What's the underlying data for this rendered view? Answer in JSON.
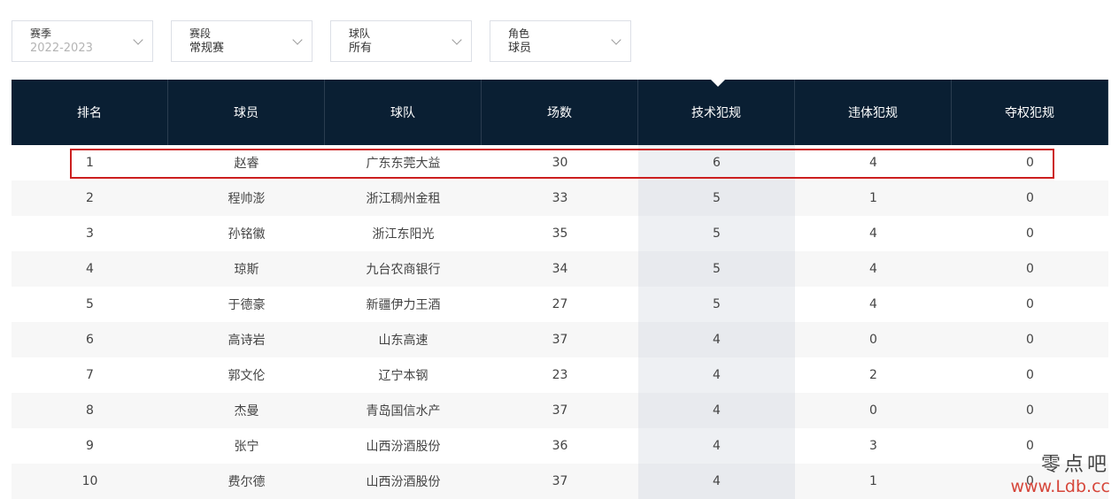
{
  "filters": [
    {
      "label": "赛季",
      "value": "2022-2023",
      "disabled": true
    },
    {
      "label": "赛段",
      "value": "常规赛",
      "disabled": false
    },
    {
      "label": "球队",
      "value": "所有",
      "disabled": false
    },
    {
      "label": "角色",
      "value": "球员",
      "disabled": false
    }
  ],
  "table": {
    "headers": [
      "排名",
      "球员",
      "球队",
      "场数",
      "技术犯规",
      "违体犯规",
      "夺权犯规"
    ],
    "sorted_column": "技术犯规",
    "rows": [
      [
        "1",
        "赵睿",
        "广东东莞大益",
        "30",
        "6",
        "4",
        "0"
      ],
      [
        "2",
        "程帅澎",
        "浙江稠州金租",
        "33",
        "5",
        "1",
        "0"
      ],
      [
        "3",
        "孙铭徽",
        "浙江东阳光",
        "35",
        "5",
        "4",
        "0"
      ],
      [
        "4",
        "琼斯",
        "九台农商银行",
        "34",
        "5",
        "4",
        "0"
      ],
      [
        "5",
        "于德豪",
        "新疆伊力王酒",
        "27",
        "5",
        "4",
        "0"
      ],
      [
        "6",
        "高诗岩",
        "山东高速",
        "37",
        "4",
        "0",
        "0"
      ],
      [
        "7",
        "郭文伦",
        "辽宁本钢",
        "23",
        "4",
        "2",
        "0"
      ],
      [
        "8",
        "杰曼",
        "青岛国信水产",
        "37",
        "4",
        "0",
        "0"
      ],
      [
        "9",
        "张宁",
        "山西汾酒股份",
        "36",
        "4",
        "3",
        "0"
      ],
      [
        "10",
        "费尔德",
        "山西汾酒股份",
        "37",
        "4",
        "1",
        "0"
      ]
    ]
  },
  "watermark": {
    "text": "零点吧",
    "url": "www.Ldb.cc"
  },
  "colors": {
    "header_bg": "#0a1f33",
    "highlight": "#cc1f1f",
    "watermark_url": "#d6463a"
  }
}
